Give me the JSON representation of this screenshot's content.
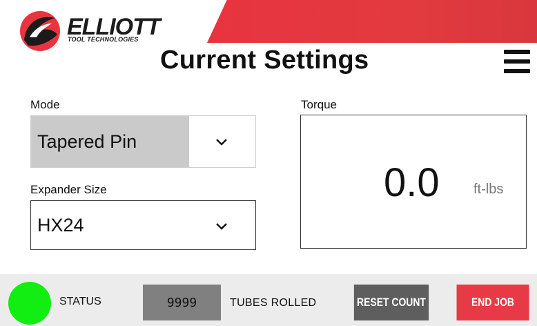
{
  "header": {
    "brand_name": "ELLIOTT",
    "brand_tagline": "TOOL TECHNOLOGIES",
    "title": "Current Settings",
    "menu_icon": "hamburger-menu-icon",
    "accent_color": "#e8343f"
  },
  "settings": {
    "mode": {
      "label": "Mode",
      "value": "Tapered Pin",
      "icon": "chevron-down-icon"
    },
    "expander_size": {
      "label": "Expander Size",
      "value": "HX24",
      "icon": "chevron-down-icon"
    },
    "torque": {
      "label": "Torque",
      "value": "0.0",
      "unit": "ft-lbs"
    }
  },
  "footer": {
    "status_label": "STATUS",
    "status_color": "#12ee12",
    "tube_count": "9999",
    "tubes_label": "TUBES ROLLED",
    "reset_label": "RESET COUNT",
    "end_label": "END JOB",
    "end_color": "#e83a46"
  }
}
